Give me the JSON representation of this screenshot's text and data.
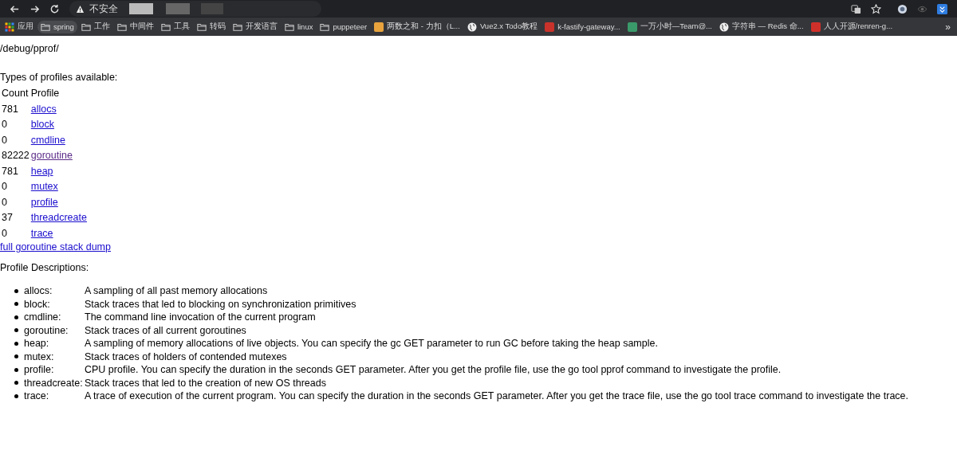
{
  "browser": {
    "address_warning": "不安全",
    "bookmarks": [
      {
        "kind": "apps",
        "label": "应用"
      },
      {
        "kind": "folder",
        "label": "spring",
        "selected": true
      },
      {
        "kind": "folder",
        "label": "工作",
        "selected": false
      },
      {
        "kind": "folder",
        "label": "中间件",
        "selected": false
      },
      {
        "kind": "folder",
        "label": "工具",
        "selected": false
      },
      {
        "kind": "folder",
        "label": "转码",
        "selected": false
      },
      {
        "kind": "folder",
        "label": "开发语言",
        "selected": false
      },
      {
        "kind": "folder",
        "label": "linux",
        "selected": false
      },
      {
        "kind": "folder",
        "label": "puppeteer",
        "selected": false
      },
      {
        "kind": "site",
        "label": "两数之和 - 力扣（L...",
        "color": "#e8a33d"
      },
      {
        "kind": "globe",
        "label": "Vue2.x Todo教程"
      },
      {
        "kind": "site",
        "label": "k-fastify-gateway...",
        "color": "#c8322a"
      },
      {
        "kind": "site",
        "label": "一万小时—Team@...",
        "color": "#3a9a6a"
      },
      {
        "kind": "globe",
        "label": "字符串 — Redis 命..."
      },
      {
        "kind": "site",
        "label": "人人开源/renren-g...",
        "color": "#d0302a"
      }
    ],
    "overflow": "»"
  },
  "page": {
    "path": "/debug/pprof/",
    "types_heading": "Types of profiles available:",
    "table": {
      "columns": [
        "Count",
        "Profile"
      ],
      "rows": [
        {
          "count": "781",
          "profile": "allocs",
          "visited": false
        },
        {
          "count": "0",
          "profile": "block",
          "visited": false
        },
        {
          "count": "0",
          "profile": "cmdline",
          "visited": false
        },
        {
          "count": "82222",
          "profile": "goroutine",
          "visited": true
        },
        {
          "count": "781",
          "profile": "heap",
          "visited": false
        },
        {
          "count": "0",
          "profile": "mutex",
          "visited": false
        },
        {
          "count": "0",
          "profile": "profile",
          "visited": false
        },
        {
          "count": "37",
          "profile": "threadcreate",
          "visited": false
        },
        {
          "count": "0",
          "profile": "trace",
          "visited": false
        }
      ]
    },
    "full_dump_link": "full goroutine stack dump",
    "descriptions_heading": "Profile Descriptions:",
    "descriptions": [
      {
        "name": "allocs:",
        "text": "A sampling of all past memory allocations"
      },
      {
        "name": "block:",
        "text": "Stack traces that led to blocking on synchronization primitives"
      },
      {
        "name": "cmdline:",
        "text": "The command line invocation of the current program"
      },
      {
        "name": "goroutine:",
        "text": "Stack traces of all current goroutines"
      },
      {
        "name": "heap:",
        "text": "A sampling of memory allocations of live objects. You can specify the gc GET parameter to run GC before taking the heap sample."
      },
      {
        "name": "mutex:",
        "text": "Stack traces of holders of contended mutexes"
      },
      {
        "name": "profile:",
        "text": "CPU profile. You can specify the duration in the seconds GET parameter. After you get the profile file, use the go tool pprof command to investigate the profile."
      },
      {
        "name": "threadcreate:",
        "text": "Stack traces that led to the creation of new OS threads"
      },
      {
        "name": "trace:",
        "text": "A trace of execution of the current program. You can specify the duration in the seconds GET parameter. After you get the trace file, use the go tool trace command to investigate the trace."
      }
    ]
  }
}
